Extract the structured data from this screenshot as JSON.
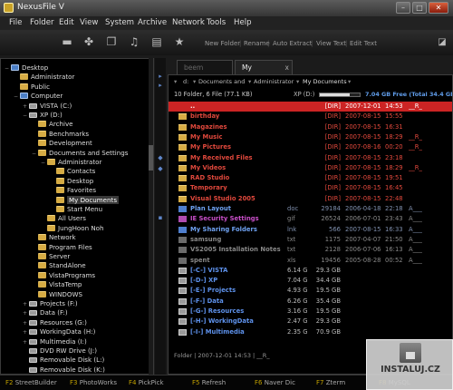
{
  "window": {
    "title": "NexusFile V",
    "minimize": "–",
    "maximize": "□",
    "close": "✕"
  },
  "menu": [
    "File",
    "Folder",
    "Edit",
    "View",
    "System",
    "Archive",
    "Network",
    "Tools",
    "Help"
  ],
  "toolbar": {
    "labels": [
      "New Folder",
      "Rename",
      "Auto Extract",
      "View Text",
      "Edit Text"
    ]
  },
  "tree": [
    {
      "label": "Desktop",
      "icon": "monitor",
      "expander": "−"
    },
    {
      "label": "Administrator",
      "icon": "folder"
    },
    {
      "label": "Public",
      "icon": "folder"
    },
    {
      "label": "Computer",
      "icon": "monitor",
      "expander": "−"
    },
    {
      "label": "VISTA (C:)",
      "icon": "drive",
      "expander": "+"
    },
    {
      "label": "XP (D:)",
      "icon": "drive",
      "expander": "−"
    },
    {
      "label": "Archive",
      "icon": "folder"
    },
    {
      "label": "Benchmarks",
      "icon": "folder"
    },
    {
      "label": "Development",
      "icon": "folder"
    },
    {
      "label": "Documents and Settings",
      "icon": "folder",
      "expander": "−"
    },
    {
      "label": "Administrator",
      "icon": "folder",
      "expander": "−"
    },
    {
      "label": "Contacts",
      "icon": "folder"
    },
    {
      "label": "Desktop",
      "icon": "folder"
    },
    {
      "label": "Favorites",
      "icon": "folder"
    },
    {
      "label": "My Documents",
      "icon": "folder",
      "selected": true
    },
    {
      "label": "Start Menu",
      "icon": "folder"
    },
    {
      "label": "All Users",
      "icon": "folder"
    },
    {
      "label": "JungHoon Noh",
      "icon": "folder"
    },
    {
      "label": "Network",
      "icon": "folder"
    },
    {
      "label": "Program Files",
      "icon": "folder"
    },
    {
      "label": "Server",
      "icon": "folder"
    },
    {
      "label": "StandAlone",
      "icon": "folder"
    },
    {
      "label": "VistaPrograms",
      "icon": "folder"
    },
    {
      "label": "VistaTemp",
      "icon": "folder"
    },
    {
      "label": "WINDOWS",
      "icon": "folder"
    },
    {
      "label": "Projects (F:)",
      "icon": "drive",
      "expander": "+"
    },
    {
      "label": "Data (F:)",
      "icon": "drive",
      "expander": "+"
    },
    {
      "label": "Resources (G:)",
      "icon": "drive",
      "expander": "+"
    },
    {
      "label": "WorkingData (H:)",
      "icon": "drive",
      "expander": "+"
    },
    {
      "label": "Multimedia (I:)",
      "icon": "drive",
      "expander": "+"
    },
    {
      "label": "DVD RW Drive (J:)",
      "icon": "drive"
    },
    {
      "label": "Removable Disk (L:)",
      "icon": "drive"
    },
    {
      "label": "Removable Disk (K:)",
      "icon": "drive"
    }
  ],
  "tabs": [
    {
      "label": "beem",
      "active": false
    },
    {
      "label": "My Documents",
      "active": true,
      "close": "x"
    }
  ],
  "path": {
    "items": [
      "d:",
      "Documents and",
      "Administrator",
      "My Documents"
    ],
    "chevron": "▾"
  },
  "panel_info": {
    "summary": "10 Folder, 6 File (77.1 KB)",
    "drive_label": "XP (D:)",
    "drive_used_fraction": 0.74,
    "free_text": "7.04 GB Free (Total 34.4 GB)"
  },
  "files": [
    {
      "name": "..",
      "ext": "",
      "size": "[DIR]",
      "date": "2007-12-01",
      "time": "14:53",
      "attr": "__R_",
      "color": "red",
      "highlight": true,
      "icon": "none"
    },
    {
      "name": "birthday",
      "ext": "",
      "size": "[DIR]",
      "date": "2007-08-15",
      "time": "15:55",
      "attr": "",
      "color": "red",
      "icon": "folder"
    },
    {
      "name": "Magazines",
      "ext": "",
      "size": "[DIR]",
      "date": "2007-08-15",
      "time": "16:31",
      "attr": "",
      "color": "red",
      "icon": "folder"
    },
    {
      "name": "My Music",
      "ext": "",
      "size": "[DIR]",
      "date": "2007-08-15",
      "time": "18:29",
      "attr": "__R_",
      "color": "red",
      "icon": "folder"
    },
    {
      "name": "My Pictures",
      "ext": "",
      "size": "[DIR]",
      "date": "2007-08-16",
      "time": "00:20",
      "attr": "__R_",
      "color": "red",
      "icon": "folder"
    },
    {
      "name": "My Received Files",
      "ext": "",
      "size": "[DIR]",
      "date": "2007-08-15",
      "time": "23:18",
      "attr": "",
      "color": "red",
      "icon": "folder"
    },
    {
      "name": "My Videos",
      "ext": "",
      "size": "[DIR]",
      "date": "2007-08-15",
      "time": "18:29",
      "attr": "__R_",
      "color": "red",
      "icon": "folder"
    },
    {
      "name": "RAD Studio",
      "ext": "",
      "size": "[DIR]",
      "date": "2007-08-15",
      "time": "19:51",
      "attr": "",
      "color": "red",
      "icon": "folder"
    },
    {
      "name": "Temporary",
      "ext": "",
      "size": "[DIR]",
      "date": "2007-08-15",
      "time": "16:45",
      "attr": "",
      "color": "red",
      "icon": "folder"
    },
    {
      "name": "Visual Studio 2005",
      "ext": "",
      "size": "[DIR]",
      "date": "2007-08-15",
      "time": "22:48",
      "attr": "",
      "color": "red",
      "icon": "folder"
    },
    {
      "name": "Plan Layout",
      "ext": "doc",
      "size": "29184",
      "date": "2006-04-18",
      "time": "22:18",
      "attr": "A___",
      "color": "blue",
      "icon": "file"
    },
    {
      "name": "IE Security Settings",
      "ext": "gif",
      "size": "26524",
      "date": "2006-07-01",
      "time": "23:43",
      "attr": "A___",
      "color": "mag",
      "icon": "file"
    },
    {
      "name": "My Sharing Folders",
      "ext": "lnk",
      "size": "566",
      "date": "2007-08-15",
      "time": "16:33",
      "attr": "A___",
      "color": "blue",
      "icon": "file"
    },
    {
      "name": "samsung",
      "ext": "txt",
      "size": "1175",
      "date": "2007-04-07",
      "time": "21:50",
      "attr": "A___",
      "color": "gray",
      "icon": "file"
    },
    {
      "name": "VS2005 Installation Notes",
      "ext": "txt",
      "size": "2128",
      "date": "2006-07-06",
      "time": "16:13",
      "attr": "A___",
      "color": "gray",
      "icon": "file"
    },
    {
      "name": "spent",
      "ext": "xls",
      "size": "19456",
      "date": "2005-08-28",
      "time": "00:52",
      "attr": "A___",
      "color": "gray",
      "icon": "file"
    },
    {
      "name": "[-C-] VISTA",
      "ext": "6.14 GB",
      "size": "29.3 GB",
      "date": "",
      "time": "",
      "attr": "",
      "color": "drive",
      "icon": "drive"
    },
    {
      "name": "[-D-] XP",
      "ext": "7.04 GB",
      "size": "34.4 GB",
      "date": "",
      "time": "",
      "attr": "",
      "color": "drive",
      "icon": "drive"
    },
    {
      "name": "[-E-] Projects",
      "ext": "4.93 GB",
      "size": "19.5 GB",
      "date": "",
      "time": "",
      "attr": "",
      "color": "drive",
      "icon": "drive"
    },
    {
      "name": "[-F-] Data",
      "ext": "6.26 GB",
      "size": "35.4 GB",
      "date": "",
      "time": "",
      "attr": "",
      "color": "drive",
      "icon": "drive"
    },
    {
      "name": "[-G-] Resources",
      "ext": "3.16 GB",
      "size": "19.5 GB",
      "date": "",
      "time": "",
      "attr": "",
      "color": "drive",
      "icon": "drive"
    },
    {
      "name": "[-H-] WorkingData",
      "ext": "2.47 GB",
      "size": "29.3 GB",
      "date": "",
      "time": "",
      "attr": "",
      "color": "drive",
      "icon": "drive"
    },
    {
      "name": "[-I-] Multimedia",
      "ext": "2.35 GB",
      "size": "70.9 GB",
      "date": "",
      "time": "",
      "attr": "",
      "color": "drive",
      "icon": "drive"
    }
  ],
  "status": "Folder | 2007-12-01 14:53 | __R_",
  "fkeys": [
    {
      "key": "F2",
      "label": "StreetBuilder"
    },
    {
      "key": "F3",
      "label": "PhotoWorks"
    },
    {
      "key": "F4",
      "label": "PickPick"
    },
    {
      "key": "F5",
      "label": "Refresh"
    },
    {
      "key": "F6",
      "label": "Naver Dic"
    },
    {
      "key": "F7",
      "label": "Zterm"
    },
    {
      "key": "F8",
      "label": "MySQL"
    }
  ],
  "watermark": "INSTALUJ.CZ",
  "icons": {
    "toolbar": [
      "film-icon",
      "pinwheel-icon",
      "documents-icon",
      "music-note-icon",
      "video-icon",
      "star-icon"
    ],
    "strip": [
      "arrow-icon",
      "arrow-icon",
      "diamond-icon",
      "diamond-icon"
    ]
  }
}
